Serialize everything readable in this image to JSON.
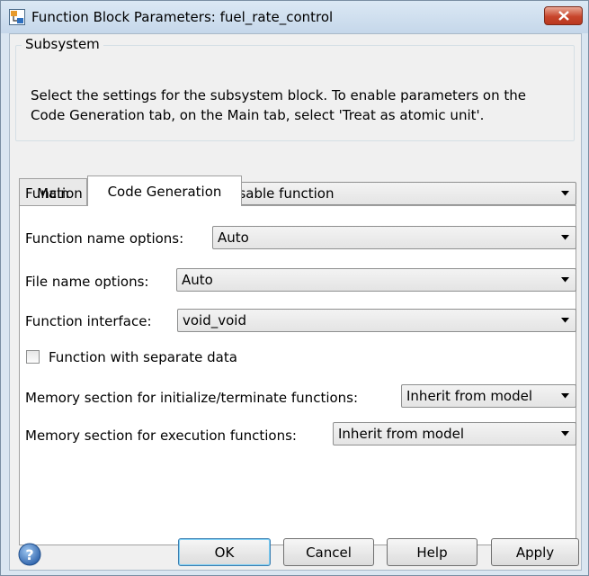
{
  "window": {
    "title": "Function Block Parameters: fuel_rate_control"
  },
  "group": {
    "legend": "Subsystem",
    "description_line1": "Select the settings for the subsystem block. To enable parameters on the",
    "description_line2": "Code Generation tab, on the Main tab, select 'Treat as atomic unit'."
  },
  "tabs": [
    {
      "label": "Main",
      "selected": false
    },
    {
      "label": "Code Generation",
      "selected": true
    }
  ],
  "form": {
    "function_packaging": {
      "label": "Function packaging:",
      "value": "Nonreusable function"
    },
    "function_name_options": {
      "label": "Function name options:",
      "value": "Auto"
    },
    "file_name_options": {
      "label": "File name options:",
      "value": "Auto"
    },
    "function_interface": {
      "label": "Function interface:",
      "value": "void_void"
    },
    "separate_data": {
      "label": "Function with separate data",
      "checked": false
    },
    "memory_init_term": {
      "label": "Memory section for initialize/terminate functions:",
      "value": "Inherit from model"
    },
    "memory_execution": {
      "label": "Memory section for execution functions:",
      "value": "Inherit from model"
    }
  },
  "buttons": {
    "ok": "OK",
    "cancel": "Cancel",
    "help": "Help",
    "apply": "Apply"
  },
  "icons": {
    "app": "simulink-block-icon",
    "close": "close-icon",
    "help": "help-question-icon",
    "dropdown": "chevron-down-icon"
  },
  "colors": {
    "close_button": "#c8462c",
    "window_frame": "#dae6f1",
    "default_button_border": "#3c7fb1"
  }
}
